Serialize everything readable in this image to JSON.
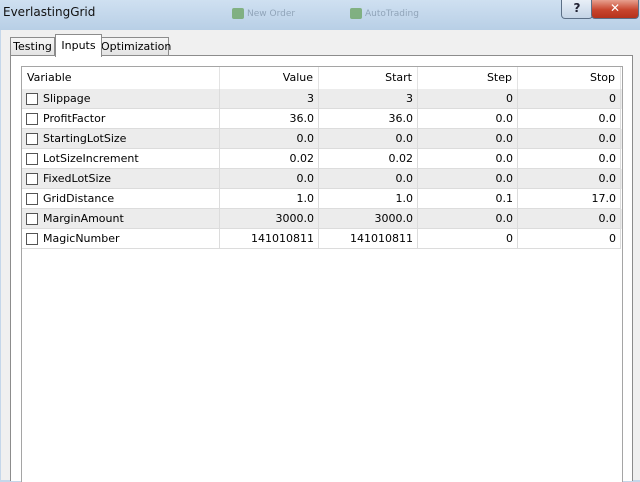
{
  "window": {
    "title": "EverlastingGrid",
    "help_label": "?",
    "close_label": "✕"
  },
  "background_toolbar": [
    "New Order",
    "AutoTrading"
  ],
  "tabs": [
    {
      "label": "Testing",
      "active": false
    },
    {
      "label": "Inputs",
      "active": true
    },
    {
      "label": "Optimization",
      "active": false
    }
  ],
  "grid": {
    "columns": [
      "Variable",
      "Value",
      "Start",
      "Step",
      "Stop"
    ],
    "rows": [
      {
        "variable": "Slippage",
        "checked": false,
        "value": "3",
        "start": "3",
        "step": "0",
        "stop": "0"
      },
      {
        "variable": "ProfitFactor",
        "checked": false,
        "value": "36.0",
        "start": "36.0",
        "step": "0.0",
        "stop": "0.0"
      },
      {
        "variable": "StartingLotSize",
        "checked": false,
        "value": "0.0",
        "start": "0.0",
        "step": "0.0",
        "stop": "0.0"
      },
      {
        "variable": "LotSizeIncrement",
        "checked": false,
        "value": "0.02",
        "start": "0.02",
        "step": "0.0",
        "stop": "0.0"
      },
      {
        "variable": "FixedLotSize",
        "checked": false,
        "value": "0.0",
        "start": "0.0",
        "step": "0.0",
        "stop": "0.0"
      },
      {
        "variable": "GridDistance",
        "checked": false,
        "value": "1.0",
        "start": "1.0",
        "step": "0.1",
        "stop": "17.0"
      },
      {
        "variable": "MarginAmount",
        "checked": false,
        "value": "3000.0",
        "start": "3000.0",
        "step": "0.0",
        "stop": "0.0"
      },
      {
        "variable": "MagicNumber",
        "checked": false,
        "value": "141010811",
        "start": "141010811",
        "step": "0",
        "stop": "0"
      }
    ]
  }
}
